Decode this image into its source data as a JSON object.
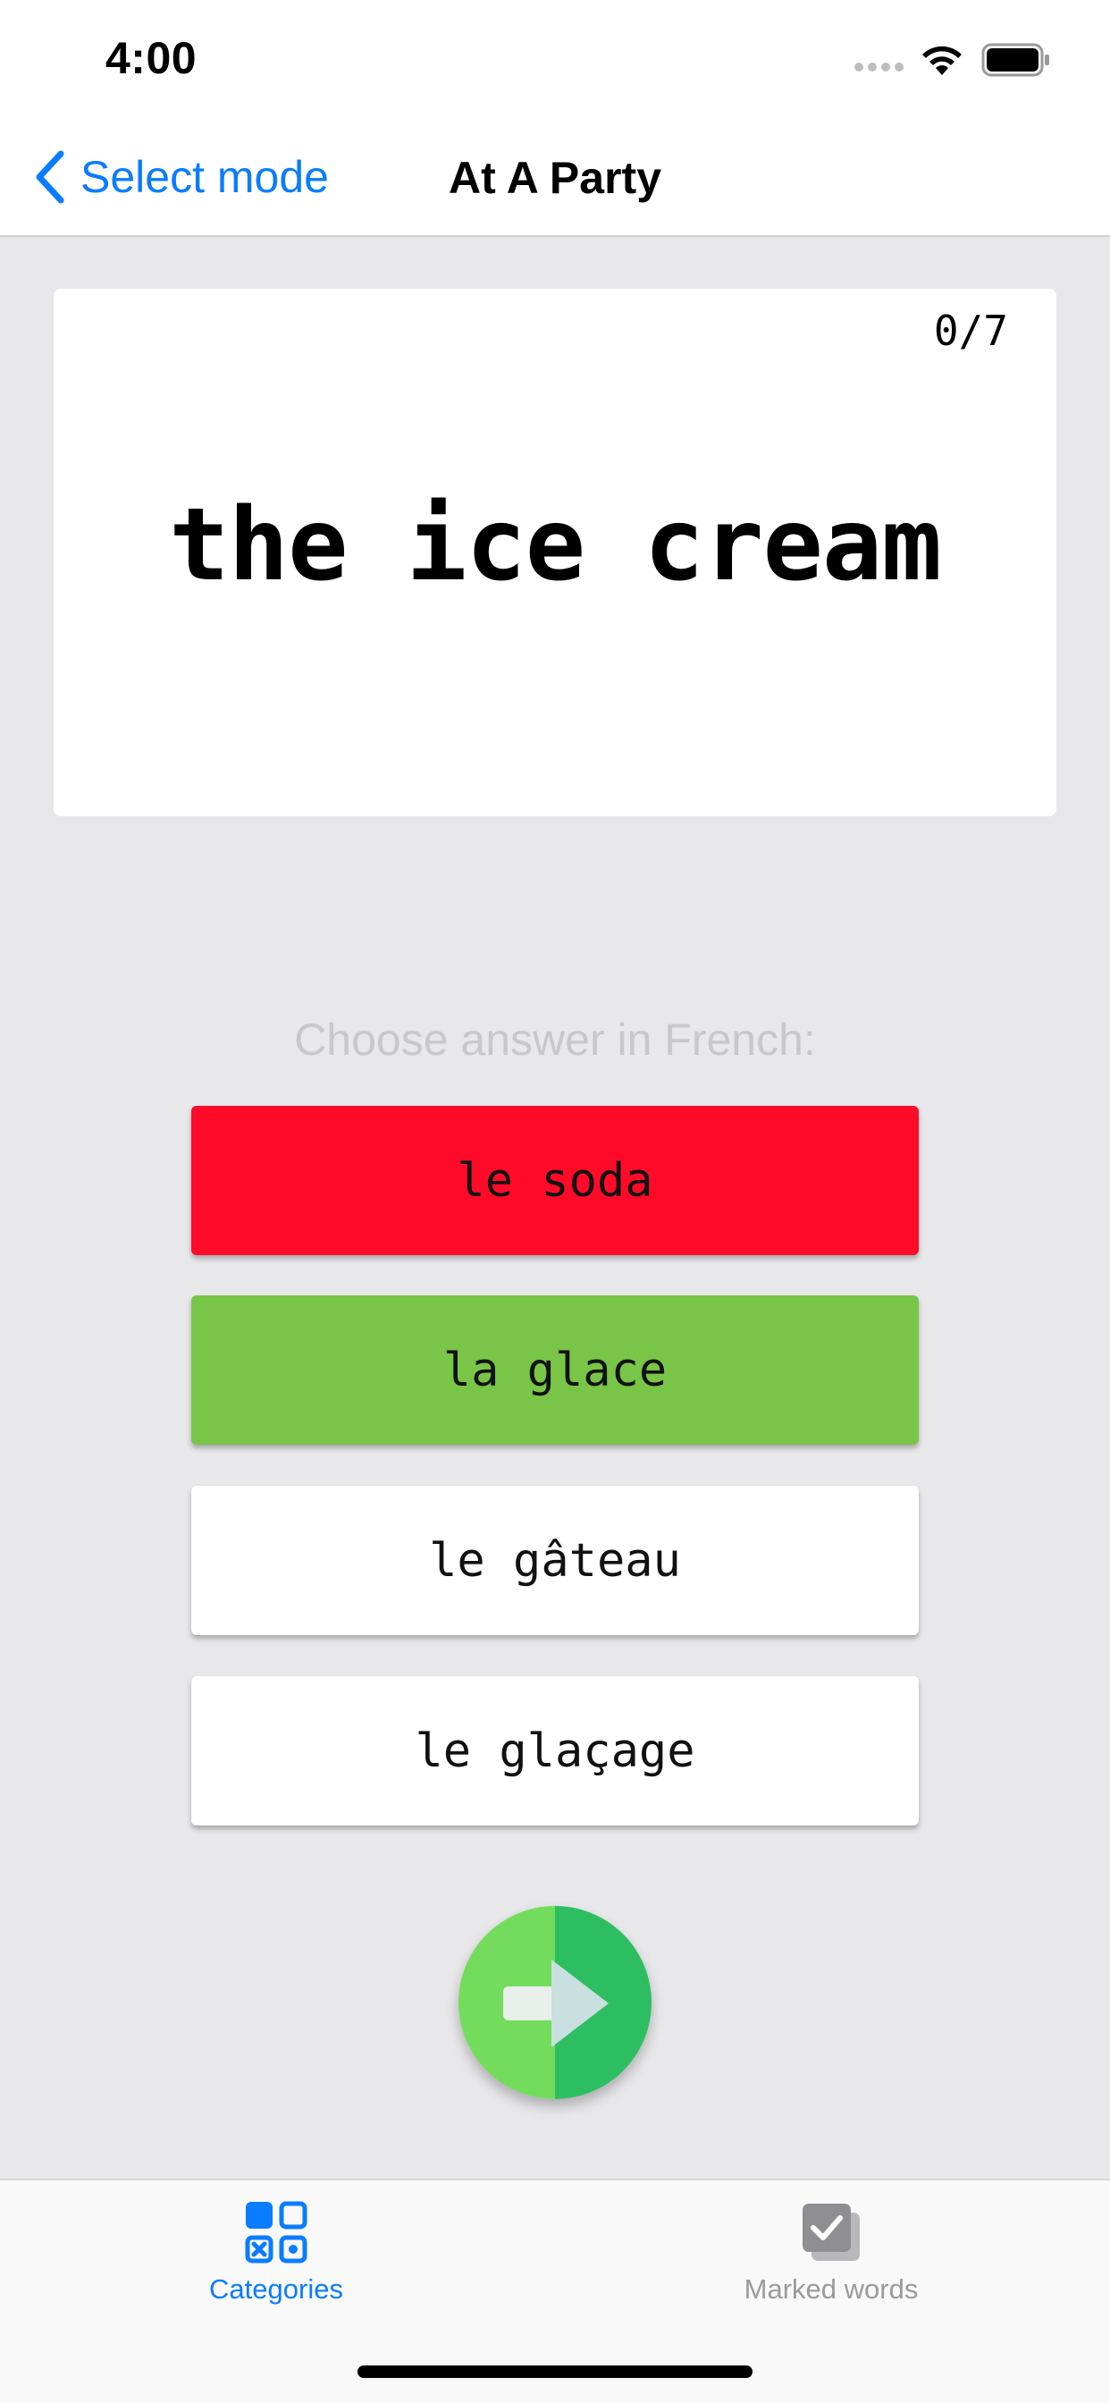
{
  "status_bar": {
    "time": "4:00"
  },
  "nav": {
    "back_label": "Select mode",
    "title": "At A Party"
  },
  "card": {
    "counter": "0/7",
    "word": "the ice cream"
  },
  "instruction": "Choose answer in French:",
  "answers": [
    {
      "label": "le soda",
      "state": "wrong",
      "color": "#ff0a28"
    },
    {
      "label": "la glace",
      "state": "correct",
      "color": "#79c547"
    },
    {
      "label": "le gâteau",
      "state": "neutral",
      "color": "#ffffff"
    },
    {
      "label": "le glaçage",
      "state": "neutral",
      "color": "#ffffff"
    }
  ],
  "next_button": {
    "icon": "arrow-right-icon"
  },
  "tabs": [
    {
      "label": "Categories",
      "icon": "grid-icon",
      "active": true
    },
    {
      "label": "Marked words",
      "icon": "checkbox-stack-icon",
      "active": false
    }
  ],
  "colors": {
    "accent": "#0a7cff",
    "background": "#e8e8eb",
    "wrong": "#ff0a28",
    "correct": "#79c547",
    "next_light": "#74dc5c",
    "next_dark": "#2ebe62"
  }
}
